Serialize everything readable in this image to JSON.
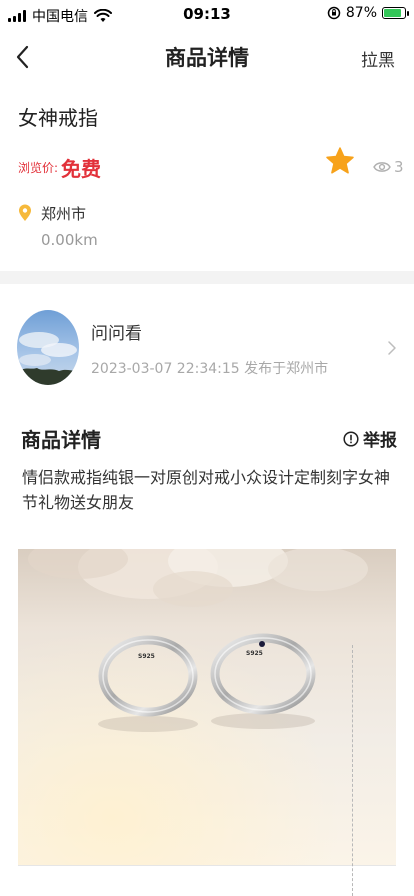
{
  "status_bar": {
    "carrier": "中国电信",
    "time": "09:13",
    "battery_percent": "87%",
    "battery_level": 0.87,
    "icons": [
      "signal-icon",
      "wifi-icon",
      "rotation-lock-icon",
      "battery-icon"
    ]
  },
  "nav": {
    "back_icon": "chevron-left-icon",
    "title": "商品详情",
    "right_action": "拉黑"
  },
  "product": {
    "title": "女神戒指",
    "price_label": "浏览价:",
    "price_value": "免费",
    "favorite_icon": "star-icon",
    "view_count": "3",
    "location_icon": "location-pin-icon",
    "city": "郑州市",
    "distance": "0.00km"
  },
  "seller": {
    "name": "问问看",
    "meta": "2023-03-07 22:34:15 发布于郑州市",
    "chevron_icon": "chevron-right-icon"
  },
  "details": {
    "title": "商品详情",
    "report_label": "举报",
    "description": "情侣款戒指纯银一对原创对戒小众设计定制刻字女神节礼物送女朋友"
  },
  "image": {
    "ring_engraving_left": "S925",
    "ring_engraving_right": "S925"
  },
  "colors": {
    "price_red": "#e2313a",
    "star_orange": "#f7a21b",
    "pin_yellow": "#f6b93b",
    "muted_gray": "#a8a8a8"
  }
}
